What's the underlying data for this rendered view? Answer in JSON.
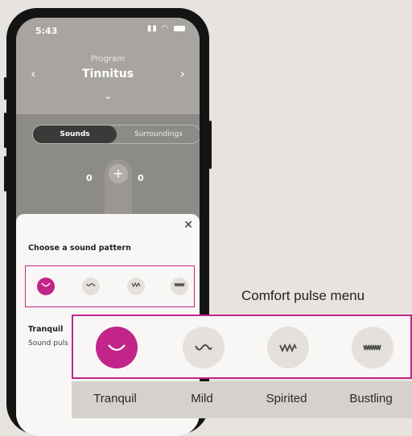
{
  "status": {
    "time": "5:43",
    "signal_icons": "signal-wifi-battery"
  },
  "program": {
    "label": "Program",
    "name": "Tinnitus"
  },
  "tabs": [
    {
      "label": "Sounds",
      "active": true
    },
    {
      "label": "Surroundings",
      "active": false
    }
  ],
  "volume": {
    "left": "0",
    "right": "0"
  },
  "sheet": {
    "title": "Choose a sound pattern",
    "selected_name": "Tranquil",
    "selected_desc": "Sound puls"
  },
  "patterns": [
    {
      "name": "Tranquil",
      "icon": "wave-tranquil-icon",
      "selected": true
    },
    {
      "name": "Mild",
      "icon": "wave-mild-icon",
      "selected": false
    },
    {
      "name": "Spirited",
      "icon": "wave-spirited-icon",
      "selected": false
    },
    {
      "name": "Bustling",
      "icon": "wave-bustling-icon",
      "selected": false
    }
  ],
  "callout": {
    "title": "Comfort pulse menu",
    "labels": [
      "Tranquil",
      "Mild",
      "Spirited",
      "Bustling"
    ]
  },
  "colors": {
    "accent": "#c2248a",
    "background": "#e7e3de",
    "sheet": "#f8f7f5"
  }
}
